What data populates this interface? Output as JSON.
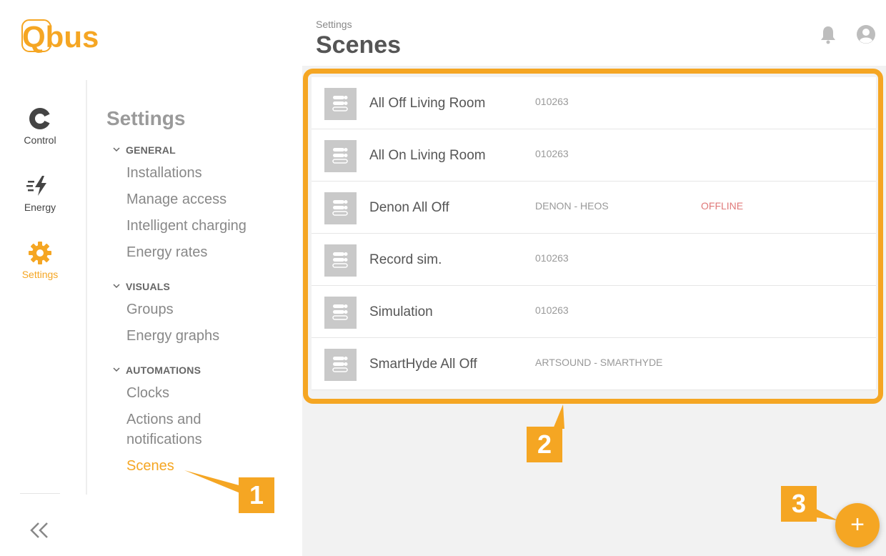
{
  "brand": {
    "logo_text": "Qbus",
    "accent": "#f5a623"
  },
  "rail": {
    "items": [
      {
        "label": "Control",
        "icon": "control-icon"
      },
      {
        "label": "Energy",
        "icon": "energy-icon"
      },
      {
        "label": "Settings",
        "icon": "gear-icon",
        "active": true
      }
    ],
    "collapse_icon": "double-chevron-left-icon"
  },
  "menu": {
    "title": "Settings",
    "sections": [
      {
        "label": "GENERAL",
        "items": [
          "Installations",
          "Manage access",
          "Intelligent charging",
          "Energy rates"
        ]
      },
      {
        "label": "VISUALS",
        "items": [
          "Groups",
          "Energy graphs"
        ]
      },
      {
        "label": "AUTOMATIONS",
        "items": [
          "Clocks",
          "Actions and notifications",
          "Scenes"
        ]
      }
    ],
    "active_item": "Scenes"
  },
  "header": {
    "breadcrumb": "Settings",
    "title": "Scenes"
  },
  "scenes": [
    {
      "name": "All Off Living Room",
      "sub": "010263",
      "status": ""
    },
    {
      "name": "All On Living Room",
      "sub": "010263",
      "status": ""
    },
    {
      "name": "Denon All Off",
      "sub": "DENON - HEOS",
      "status": "OFFLINE"
    },
    {
      "name": "Record sim.",
      "sub": "010263",
      "status": ""
    },
    {
      "name": "Simulation",
      "sub": "010263",
      "status": ""
    },
    {
      "name": "SmartHyde All Off",
      "sub": "ARTSOUND - SMARTHYDE",
      "status": ""
    }
  ],
  "fab": {
    "label": "+"
  },
  "annotations": {
    "badge1": "1",
    "badge2": "2",
    "badge3": "3"
  }
}
